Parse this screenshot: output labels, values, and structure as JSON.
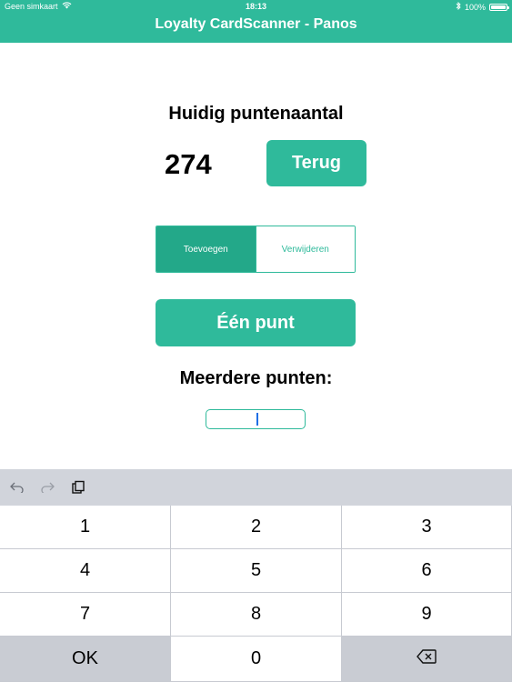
{
  "status_bar": {
    "carrier": "Geen simkaart",
    "time": "18:13",
    "battery": "100%"
  },
  "header": {
    "title": "Loyalty CardScanner - Panos"
  },
  "main": {
    "points_title": "Huidig puntenaantal",
    "points_value": "274",
    "back_label": "Terug",
    "segment": [
      {
        "label": "Toevoegen",
        "selected": true
      },
      {
        "label": "Verwijderen",
        "selected": false
      }
    ],
    "one_point_label": "Één punt",
    "multi_label": "Meerdere punten:",
    "multi_input_value": ""
  },
  "keyboard": {
    "toolbar_icons": [
      "undo-icon",
      "redo-icon",
      "paste-icon"
    ],
    "rows": [
      [
        "1",
        "2",
        "3"
      ],
      [
        "4",
        "5",
        "6"
      ],
      [
        "7",
        "8",
        "9"
      ],
      [
        "OK",
        "0",
        "backspace"
      ]
    ]
  },
  "colors": {
    "accent": "#2fba9b",
    "accent_dark": "#23a889"
  }
}
